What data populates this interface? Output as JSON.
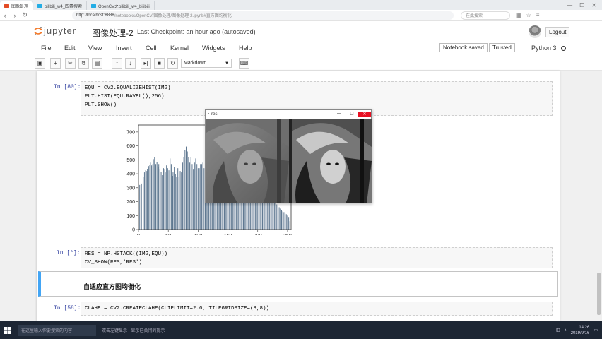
{
  "browser": {
    "tabs": [
      {
        "label": "图像处理",
        "color": "#e34c26"
      },
      {
        "label": "bilibili_w4_四素搜索",
        "color": "#23ade5"
      },
      {
        "label": "OpenCV之bilibili_w4_bilibili",
        "color": "#23ade5"
      }
    ],
    "url_host": "http://localhost:8888",
    "url_path": "/notebooks/OpenCV/图像处理/图像处理-2.ipynb#直方图均衡化",
    "search_placeholder": "在此搜索",
    "window_controls": [
      "—",
      "☐",
      "✕"
    ]
  },
  "header": {
    "logo_text": "jupyter",
    "notebook_title": "图像处理-2",
    "checkpoint": "Last Checkpoint: an hour ago (autosaved)",
    "logout": "Logout"
  },
  "menu": {
    "items": [
      "File",
      "Edit",
      "View",
      "Insert",
      "Cell",
      "Kernel",
      "Widgets",
      "Help"
    ],
    "notebook_saved": "Notebook saved",
    "trusted": "Trusted",
    "kernel": "Python 3"
  },
  "toolbar": {
    "buttons": [
      "save-icon",
      "plus-icon",
      "scissors-icon",
      "copy-icon",
      "paste-icon",
      "arrow-up-icon",
      "arrow-down-icon",
      "run-icon",
      "stop-icon",
      "restart-icon",
      "keyboard-icon"
    ],
    "cell_type": "Markdown"
  },
  "cells": {
    "c1_prompt": "In [80]:",
    "c1_code": "EQU = CV2.EQUALIZEHIST(IMG)\nPLT.HIST(EQU.RAVEL(),256)\nPLT.SHOW()",
    "c2_prompt": "In [*]:",
    "c2_code": "RES = NP.HSTACK((IMG,EQU))\nCV_SHOW(RES,'RES')",
    "md_text": "自适应直方图均衡化",
    "c3_prompt": "In [58]:",
    "c3_code": "CLAHE = CV2.CREATECLAHE(CLIPLIMIT=2.0, TILEGRIDSIZE=(8,8))"
  },
  "image_window": {
    "title": "res"
  },
  "chart_data": {
    "type": "bar",
    "xlim": [
      0,
      256
    ],
    "ylim": [
      0,
      750
    ],
    "xticks": [
      0,
      50,
      100,
      150,
      200,
      250
    ],
    "yticks": [
      0,
      100,
      200,
      300,
      400,
      500,
      600,
      700
    ],
    "bar_color": "#5f7891",
    "x": [
      2,
      5,
      8,
      10,
      12,
      14,
      15,
      17,
      19,
      20,
      22,
      24,
      25,
      27,
      29,
      31,
      33,
      34,
      36,
      38,
      40,
      42,
      44,
      45,
      47,
      49,
      51,
      53,
      55,
      57,
      58,
      60,
      62,
      64,
      66,
      68,
      70,
      72,
      74,
      76,
      78,
      80,
      82,
      84,
      86,
      88,
      90,
      92,
      94,
      96,
      98,
      100,
      102,
      104,
      106,
      108,
      110,
      112,
      114,
      116,
      118,
      120,
      122,
      124,
      126,
      128,
      130,
      132,
      134,
      136,
      138,
      140,
      142,
      144,
      146,
      148,
      150,
      152,
      154,
      156,
      158,
      160,
      162,
      164,
      166,
      168,
      170,
      172,
      174,
      176,
      178,
      180,
      182,
      184,
      186,
      188,
      190,
      192,
      194,
      196,
      198,
      200,
      202,
      204,
      206,
      208,
      210,
      212,
      214,
      216,
      218,
      220,
      222,
      224,
      226,
      228,
      230,
      232,
      234,
      236,
      238,
      240,
      242,
      244,
      246,
      248,
      250,
      252,
      254
    ],
    "y": [
      320,
      330,
      380,
      410,
      425,
      420,
      435,
      455,
      465,
      480,
      460,
      470,
      505,
      520,
      470,
      485,
      450,
      470,
      430,
      415,
      390,
      440,
      430,
      410,
      460,
      440,
      425,
      510,
      470,
      385,
      410,
      450,
      400,
      380,
      440,
      380,
      420,
      410,
      480,
      520,
      570,
      595,
      560,
      520,
      480,
      520,
      470,
      430,
      480,
      510,
      470,
      440,
      440,
      470,
      470,
      480,
      440,
      460,
      420,
      390,
      360,
      300,
      390,
      420,
      400,
      480,
      440,
      460,
      450,
      470,
      480,
      500,
      520,
      480,
      420,
      440,
      480,
      500,
      460,
      400,
      380,
      430,
      460,
      470,
      420,
      440,
      460,
      470,
      490,
      480,
      470,
      440,
      420,
      410,
      430,
      450,
      470,
      480,
      490,
      460,
      440,
      420,
      410,
      400,
      380,
      360,
      340,
      320,
      300,
      280,
      260,
      240,
      230,
      220,
      210,
      200,
      190,
      180,
      170,
      160,
      150,
      140,
      130,
      125,
      120,
      110,
      100,
      90,
      60
    ],
    "title": "",
    "xlabel": "",
    "ylabel": ""
  },
  "taskbar": {
    "search": "在这里输入你要搜索的内容",
    "notice": "双击左键显示 · 显示已关闭的提示",
    "clock_time": "14:26",
    "clock_date": "2019/9/16"
  }
}
